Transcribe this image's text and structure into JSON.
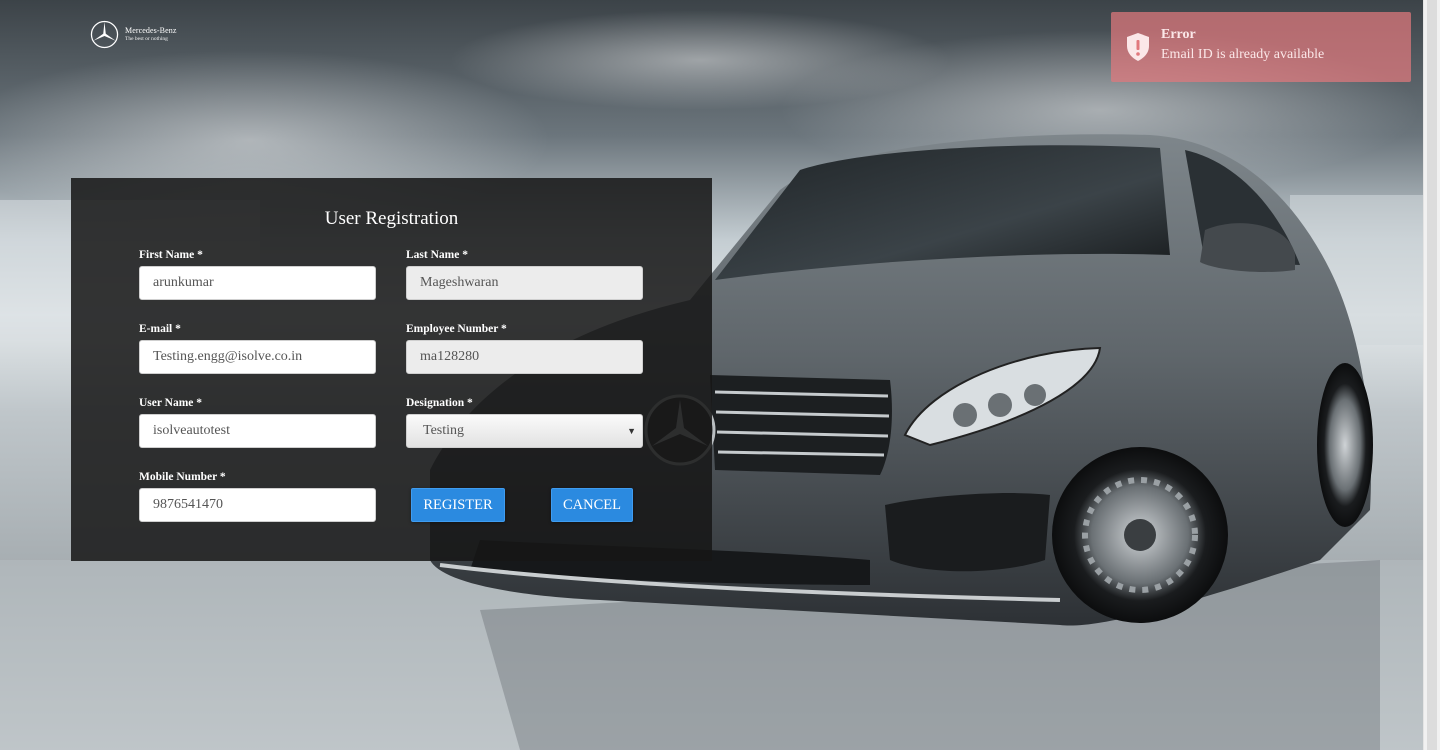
{
  "logo": {
    "brand": "Mercedes-Benz",
    "tagline": "The best or nothing"
  },
  "toast": {
    "title": "Error",
    "message": "Email ID is already available",
    "icon": "shield-alert-icon"
  },
  "form": {
    "title": "User Registration",
    "first_name": {
      "label": "First Name *",
      "value": "arunkumar"
    },
    "last_name": {
      "label": "Last Name *",
      "value": "Mageshwaran"
    },
    "email": {
      "label": "E-mail *",
      "value": "Testing.engg@isolve.co.in"
    },
    "employee_number": {
      "label": "Employee Number *",
      "value": "ma128280"
    },
    "user_name": {
      "label": "User Name *",
      "value": "isolveautotest"
    },
    "designation": {
      "label": "Designation *",
      "value": "Testing"
    },
    "mobile_number": {
      "label": "Mobile Number *",
      "value": "9876541470"
    },
    "register_label": "REGISTER",
    "cancel_label": "CANCEL"
  },
  "colors": {
    "panel_bg": "#161616",
    "button_blue": "#2b8ae0",
    "toast_bg": "#e1787d"
  }
}
